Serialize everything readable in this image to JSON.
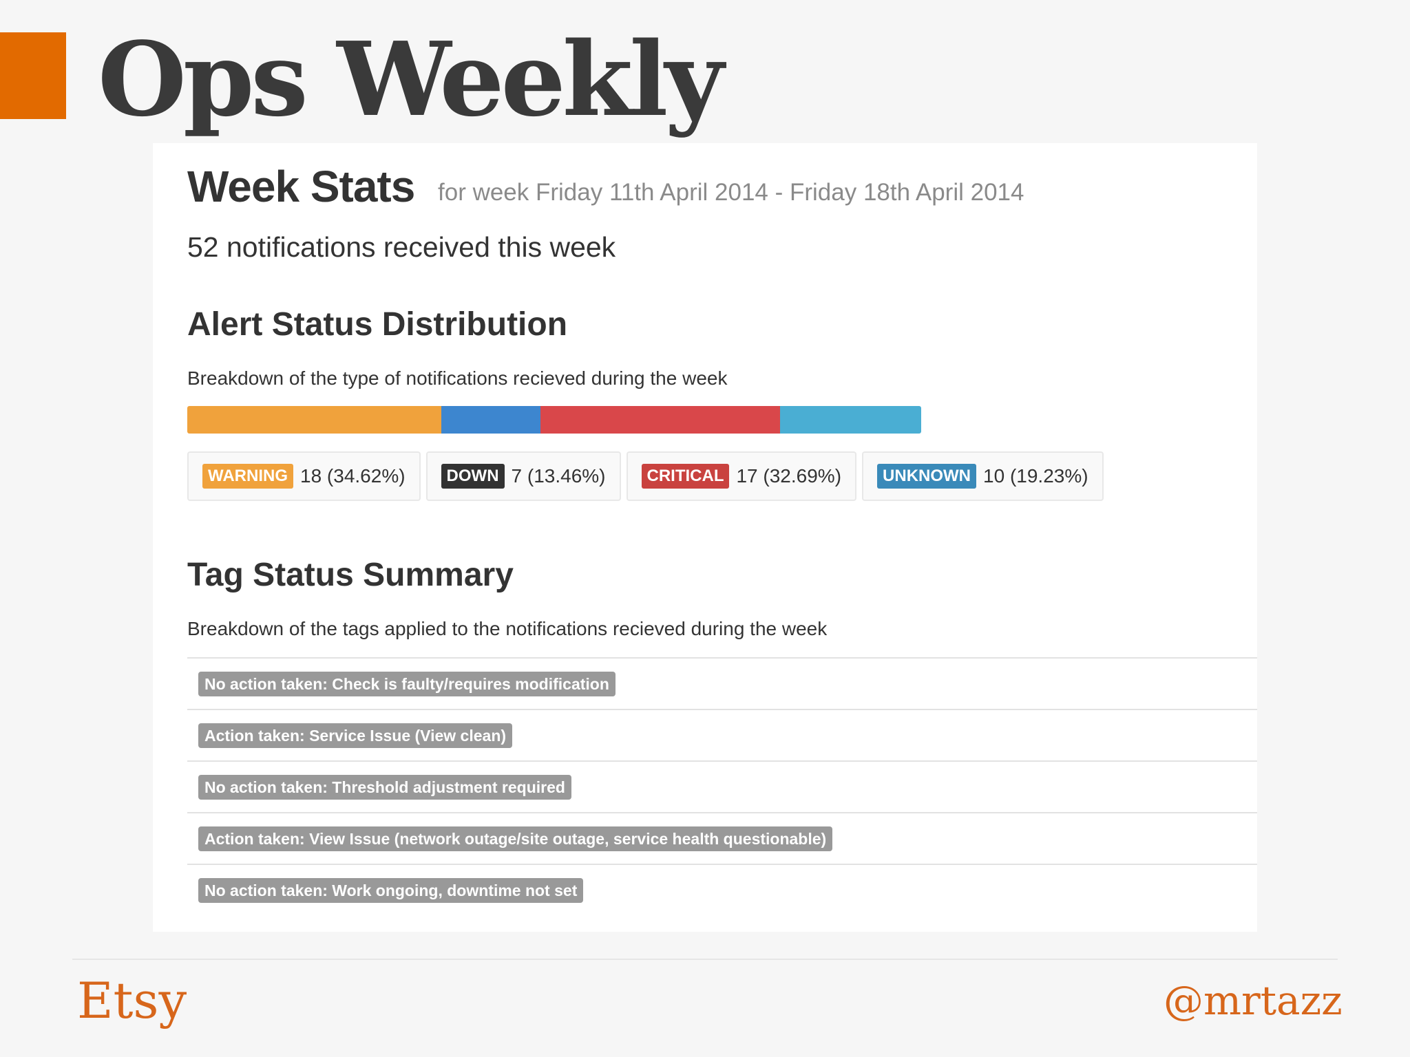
{
  "slide": {
    "title": "Ops Weekly",
    "accent_color": "#e26a00"
  },
  "week_stats": {
    "heading": "Week Stats",
    "subheading": "for week Friday 11th April 2014 - Friday 18th April 2014",
    "notifications": "52 notifications received this week"
  },
  "alert_dist": {
    "heading": "Alert Status Distribution",
    "description": "Breakdown of the type of notifications recieved during the week",
    "segments": [
      {
        "label": "WARNING",
        "count": "18 (34.62%)",
        "percent": 34.62,
        "color": "#f0a23c"
      },
      {
        "label": "DOWN",
        "count": "7 (13.46%)",
        "percent": 13.46,
        "color": "#333333"
      },
      {
        "label": "CRITICAL",
        "count": "17 (32.69%)",
        "percent": 32.69,
        "color": "#c9423f"
      },
      {
        "label": "UNKNOWN",
        "count": "10 (19.23%)",
        "percent": 19.23,
        "color": "#3a8ab9"
      }
    ],
    "bar_colors": [
      "#f0a23c",
      "#3d86cf",
      "#d9474a",
      "#4aaed3"
    ]
  },
  "tag_summary": {
    "heading": "Tag Status Summary",
    "description": "Breakdown of the tags applied to the notifications recieved during the week",
    "tags": [
      "No action taken: Check is faulty/requires modification",
      "Action taken: Service Issue (View clean)",
      "No action taken: Threshold adjustment required",
      "Action taken: View Issue (network outage/site outage, service health questionable)",
      "No action taken: Work ongoing, downtime not set"
    ]
  },
  "footer": {
    "left": "Etsy",
    "right": "@mrtazz",
    "color": "#d7661b"
  }
}
